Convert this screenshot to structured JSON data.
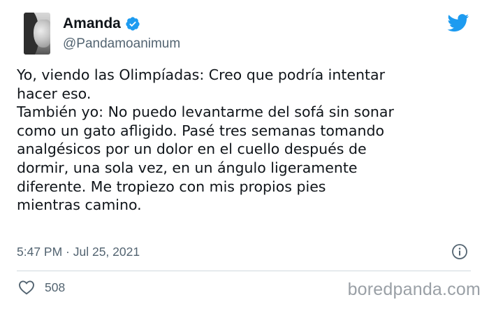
{
  "user": {
    "display_name": "Amanda",
    "handle": "@Pandamoanimum",
    "verified": true
  },
  "tweet": {
    "text": "Yo, viendo las Olimpíadas: Creo que podría intentar\nhacer eso.\nTambién yo: No puedo levantarme del sofá sin sonar\ncomo un gato afligido. Pasé tres semanas tomando\nanalgésicos por un dolor en el cuello después de\ndormir, una sola vez, en un ángulo ligeramente\ndiferente. Me tropiezo con mis propios pies\nmientras camino.",
    "timestamp": "5:47 PM · Jul 25, 2021",
    "likes": "508"
  },
  "watermark": "boredpanda.com",
  "icons": {
    "verified": "verified-badge-icon",
    "brand": "twitter-bird-icon",
    "info": "info-icon",
    "like": "heart-icon"
  },
  "colors": {
    "twitter_blue": "#1d9bf0",
    "secondary_text": "#536471",
    "primary_text": "#0f1419",
    "watermark": "#9aa0a6"
  }
}
